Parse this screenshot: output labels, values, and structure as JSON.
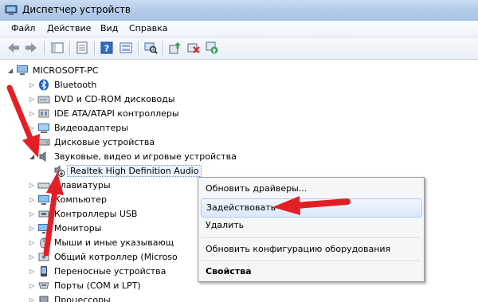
{
  "window": {
    "title": "Диспетчер устройств"
  },
  "menu": [
    "Файл",
    "Действие",
    "Вид",
    "Справка"
  ],
  "tree": {
    "root": "MICROSOFT-PC",
    "items": [
      {
        "label": "Bluetooth",
        "icon": "bluetooth-icon",
        "expanded": false
      },
      {
        "label": "DVD и CD-ROM дисководы",
        "icon": "dvd-drive-icon",
        "expanded": false
      },
      {
        "label": "IDE ATA/ATAPI контроллеры",
        "icon": "ide-controller-icon",
        "expanded": false
      },
      {
        "label": "Видеоадаптеры",
        "icon": "display-adapter-icon",
        "expanded": false
      },
      {
        "label": "Дисковые устройства",
        "icon": "disk-drive-icon",
        "expanded": false
      },
      {
        "label": "Звуковые, видео и игровые устройства",
        "icon": "sound-device-icon",
        "expanded": true
      },
      {
        "label": "Realtek High Definition Audio",
        "icon": "disabled-device-icon",
        "child": true,
        "selected": true
      },
      {
        "label": "Клавиатуры",
        "icon": "keyboard-icon",
        "expanded": false
      },
      {
        "label": "Компьютер",
        "icon": "computer-icon",
        "expanded": false
      },
      {
        "label": "Контроллеры USB",
        "icon": "usb-controller-icon",
        "expanded": false
      },
      {
        "label": "Мониторы",
        "icon": "monitor-icon",
        "expanded": false
      },
      {
        "label": "Мыши и иные указывающ",
        "icon": "mouse-icon",
        "expanded": false
      },
      {
        "label": "Общий котроллер (Microso",
        "icon": "generic-controller-icon",
        "expanded": false
      },
      {
        "label": "Переносные устройства",
        "icon": "portable-device-icon",
        "expanded": false
      },
      {
        "label": "Порты (COM и LPT)",
        "icon": "port-icon",
        "expanded": false
      },
      {
        "label": "Процессоры",
        "icon": "processor-icon",
        "expanded": false
      }
    ]
  },
  "context_menu": {
    "items": [
      {
        "label": "Обновить драйверы..."
      },
      {
        "label": "Задействовать",
        "highlighted": true
      },
      {
        "label": "Удалить"
      },
      {
        "label": "Обновить конфигурацию оборудования"
      },
      {
        "label": "Свойства",
        "bold": true
      }
    ]
  },
  "colors": {
    "arrow": "#e31e24",
    "titlebar": "#b6cde9",
    "menu_hover": "#dbe8fa"
  }
}
